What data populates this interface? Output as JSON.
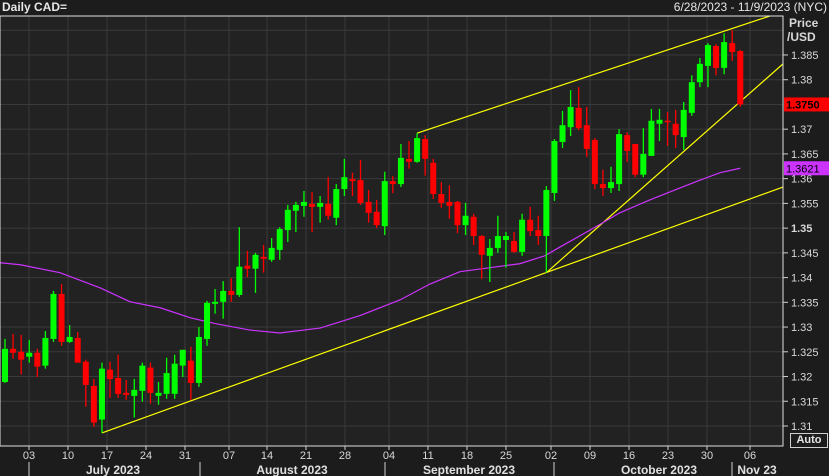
{
  "header": {
    "title": "Daily CAD=",
    "date_range": "6/28/2023 - 11/9/2023 (NYC)"
  },
  "axis": {
    "price_title_1": "Price",
    "price_title_2": "/USD",
    "auto_label": "Auto"
  },
  "colors": {
    "up": "#00ff00",
    "down": "#ff0000",
    "ma": "#cc33ff",
    "trendline": "#ffff00",
    "background": "#222222",
    "grid": "#3a3a3a"
  },
  "chart_data": {
    "type": "candlestick",
    "title": "Daily CAD=",
    "ylabel": "Price /USD",
    "ylim": [
      1.3065,
      1.3935
    ],
    "grid": true,
    "y_ticks": [
      "1.385",
      "1.38",
      "1.37",
      "1.365",
      "1.36",
      "1.355",
      "1.35",
      "1.345",
      "1.34",
      "1.335",
      "1.33",
      "1.325",
      "1.32",
      "1.315",
      "1.31"
    ],
    "y_tick_values": [
      1.385,
      1.38,
      1.37,
      1.365,
      1.36,
      1.355,
      1.35,
      1.345,
      1.34,
      1.335,
      1.33,
      1.325,
      1.32,
      1.315,
      1.31
    ],
    "x_ticks": [
      "03",
      "10",
      "17",
      "24",
      "31",
      "07",
      "14",
      "21",
      "28",
      "04",
      "11",
      "18",
      "25",
      "02",
      "09",
      "16",
      "23",
      "30",
      "06"
    ],
    "months": [
      "July 2023",
      "August 2023",
      "September 2023",
      "October 2023",
      "Nov 23"
    ],
    "last_price_label": "1.3750",
    "ma_label": "1.3621",
    "candles_ohlc": [
      [
        1.3189,
        1.3276,
        1.3187,
        1.3256
      ],
      [
        1.3256,
        1.3286,
        1.3236,
        1.3248
      ],
      [
        1.325,
        1.3284,
        1.3204,
        1.3234
      ],
      [
        1.324,
        1.3274,
        1.3228,
        1.3248
      ],
      [
        1.3248,
        1.3256,
        1.3199,
        1.322
      ],
      [
        1.3222,
        1.3292,
        1.3216,
        1.3278
      ],
      [
        1.3276,
        1.3373,
        1.327,
        1.3367
      ],
      [
        1.3367,
        1.3387,
        1.3262,
        1.327
      ],
      [
        1.327,
        1.3304,
        1.3268,
        1.328
      ],
      [
        1.3278,
        1.329,
        1.3228,
        1.3228
      ],
      [
        1.323,
        1.3234,
        1.3139,
        1.3183
      ],
      [
        1.3181,
        1.3195,
        1.3098,
        1.3107
      ],
      [
        1.3113,
        1.3228,
        1.3086,
        1.3216
      ],
      [
        1.3214,
        1.323,
        1.3157,
        1.3195
      ],
      [
        1.3197,
        1.3244,
        1.3157,
        1.3165
      ],
      [
        1.3167,
        1.3193,
        1.3153,
        1.3163
      ],
      [
        1.3161,
        1.3195,
        1.3117,
        1.3173
      ],
      [
        1.3171,
        1.3228,
        1.3149,
        1.3222
      ],
      [
        1.3218,
        1.3228,
        1.3145,
        1.3167
      ],
      [
        1.3161,
        1.3189,
        1.3143,
        1.3167
      ],
      [
        1.3165,
        1.3238,
        1.3155,
        1.3207
      ],
      [
        1.3165,
        1.3244,
        1.3155,
        1.3226
      ],
      [
        1.3222,
        1.3254,
        1.3199,
        1.3254
      ],
      [
        1.3232,
        1.326,
        1.3153,
        1.3187
      ],
      [
        1.3187,
        1.33,
        1.3179,
        1.328
      ],
      [
        1.3276,
        1.3353,
        1.3262,
        1.3349
      ],
      [
        1.3347,
        1.3377,
        1.3327,
        1.3351
      ],
      [
        1.3351,
        1.3393,
        1.3317,
        1.3373
      ],
      [
        1.3373,
        1.3399,
        1.3351,
        1.3365
      ],
      [
        1.3365,
        1.3502,
        1.3361,
        1.3422
      ],
      [
        1.3424,
        1.3454,
        1.3401,
        1.3418
      ],
      [
        1.3418,
        1.345,
        1.3369,
        1.3446
      ],
      [
        1.3442,
        1.3466,
        1.341,
        1.3438
      ],
      [
        1.3436,
        1.348,
        1.3432,
        1.346
      ],
      [
        1.3456,
        1.3502,
        1.3436,
        1.3498
      ],
      [
        1.3496,
        1.3547,
        1.3472,
        1.3537
      ],
      [
        1.3535,
        1.3553,
        1.3492,
        1.3547
      ],
      [
        1.3545,
        1.3575,
        1.3523,
        1.3553
      ],
      [
        1.3549,
        1.3573,
        1.3492,
        1.3543
      ],
      [
        1.3543,
        1.3565,
        1.3511,
        1.3551
      ],
      [
        1.3549,
        1.3603,
        1.3517,
        1.3525
      ],
      [
        1.3521,
        1.3589,
        1.3506,
        1.3579
      ],
      [
        1.3579,
        1.364,
        1.3565,
        1.3603
      ],
      [
        1.3599,
        1.3612,
        1.3565,
        1.3595
      ],
      [
        1.3597,
        1.3638,
        1.3547,
        1.3551
      ],
      [
        1.3553,
        1.3577,
        1.3511,
        1.3531
      ],
      [
        1.3533,
        1.3557,
        1.35,
        1.3506
      ],
      [
        1.3504,
        1.3614,
        1.3486,
        1.3595
      ],
      [
        1.3595,
        1.3605,
        1.3571,
        1.3589
      ],
      [
        1.3589,
        1.367,
        1.3583,
        1.3642
      ],
      [
        1.364,
        1.3676,
        1.362,
        1.3634
      ],
      [
        1.3634,
        1.3692,
        1.3632,
        1.3682
      ],
      [
        1.368,
        1.3688,
        1.3606,
        1.364
      ],
      [
        1.3632,
        1.364,
        1.3559,
        1.3569
      ],
      [
        1.3569,
        1.3593,
        1.3541,
        1.3551
      ],
      [
        1.3553,
        1.3587,
        1.3519,
        1.3545
      ],
      [
        1.3553,
        1.3555,
        1.349,
        1.3506
      ],
      [
        1.3506,
        1.3551,
        1.3486,
        1.3525
      ],
      [
        1.3523,
        1.3529,
        1.3466,
        1.3484
      ],
      [
        1.3484,
        1.3486,
        1.3397,
        1.3446
      ],
      [
        1.3444,
        1.3478,
        1.3391,
        1.346
      ],
      [
        1.346,
        1.3525,
        1.345,
        1.3484
      ],
      [
        1.3476,
        1.3492,
        1.342,
        1.3484
      ],
      [
        1.3474,
        1.3492,
        1.345,
        1.3452
      ],
      [
        1.3452,
        1.3529,
        1.3444,
        1.3517
      ],
      [
        1.3517,
        1.3543,
        1.3484,
        1.3494
      ],
      [
        1.3496,
        1.3525,
        1.3466,
        1.3484
      ],
      [
        1.3484,
        1.3585,
        1.341,
        1.3577
      ],
      [
        1.3571,
        1.368,
        1.3555,
        1.3676
      ],
      [
        1.3674,
        1.3737,
        1.3662,
        1.3708
      ],
      [
        1.3704,
        1.3779,
        1.3686,
        1.3745
      ],
      [
        1.3743,
        1.3785,
        1.3698,
        1.3702
      ],
      [
        1.3708,
        1.3745,
        1.3644,
        1.366
      ],
      [
        1.3678,
        1.3682,
        1.3579,
        1.3589
      ],
      [
        1.3589,
        1.3618,
        1.3565,
        1.3581
      ],
      [
        1.3581,
        1.3624,
        1.3571,
        1.3593
      ],
      [
        1.3589,
        1.37,
        1.3575,
        1.369
      ],
      [
        1.3688,
        1.3694,
        1.3634,
        1.3656
      ],
      [
        1.367,
        1.367,
        1.3603,
        1.3608
      ],
      [
        1.3608,
        1.3702,
        1.3603,
        1.365
      ],
      [
        1.3646,
        1.3741,
        1.3646,
        1.3717
      ],
      [
        1.3711,
        1.3741,
        1.3676,
        1.3719
      ],
      [
        1.3717,
        1.3735,
        1.3666,
        1.3715
      ],
      [
        1.3711,
        1.3739,
        1.3662,
        1.3688
      ],
      [
        1.3684,
        1.3755,
        1.3658,
        1.3739
      ],
      [
        1.3733,
        1.3809,
        1.3727,
        1.3795
      ],
      [
        1.3795,
        1.3844,
        1.3785,
        1.3832
      ],
      [
        1.3828,
        1.3874,
        1.3785,
        1.387
      ],
      [
        1.3868,
        1.3872,
        1.3809,
        1.3824
      ],
      [
        1.3824,
        1.3894,
        1.3811,
        1.3876
      ],
      [
        1.3874,
        1.39,
        1.3838,
        1.3856
      ],
      [
        1.3858,
        1.386,
        1.3745,
        1.375
      ]
    ],
    "moving_average": [
      [
        -0.6,
        1.343
      ],
      [
        1.9,
        1.3426
      ],
      [
        6.8,
        1.341
      ],
      [
        11.8,
        1.3379
      ],
      [
        15.5,
        1.3351
      ],
      [
        19.2,
        1.3339
      ],
      [
        22.9,
        1.3319
      ],
      [
        26,
        1.3307
      ],
      [
        30.3,
        1.3294
      ],
      [
        34,
        1.3288
      ],
      [
        39,
        1.3298
      ],
      [
        43.9,
        1.3323
      ],
      [
        48.9,
        1.3355
      ],
      [
        52.6,
        1.3387
      ],
      [
        56.3,
        1.3412
      ],
      [
        60,
        1.342
      ],
      [
        63.7,
        1.3428
      ],
      [
        66.8,
        1.3444
      ],
      [
        68.7,
        1.3462
      ],
      [
        72.4,
        1.3496
      ],
      [
        76.1,
        1.3531
      ],
      [
        79.8,
        1.3557
      ],
      [
        83.5,
        1.3581
      ],
      [
        86,
        1.3597
      ],
      [
        88.5,
        1.3612
      ],
      [
        91,
        1.3621
      ]
    ],
    "trendlines": [
      {
        "name": "lower-channel",
        "from": [
          12,
          1.3086
        ],
        "to": [
          96.3,
          1.3583
        ]
      },
      {
        "name": "upper-channel",
        "from": [
          51,
          1.3692
        ],
        "to": [
          94.7,
          1.3929
        ]
      },
      {
        "name": "steep-support",
        "from": [
          67,
          1.341
        ],
        "to": [
          96.3,
          1.3832
        ]
      }
    ]
  }
}
